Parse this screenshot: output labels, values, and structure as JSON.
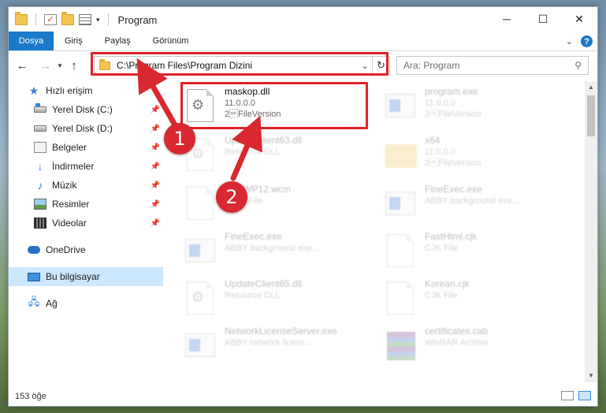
{
  "window": {
    "title": "Program",
    "controls": {
      "minimize": "─",
      "maximize": "☐",
      "close": "✕"
    }
  },
  "ribbon": {
    "tabs": [
      "Dosya",
      "Giriş",
      "Paylaş",
      "Görünüm"
    ],
    "help": "?"
  },
  "navigation": {
    "address": "C:\\Program Files\\Program Dizini",
    "search_placeholder": "Ara: Program"
  },
  "sidebar": {
    "quick_access": "Hızlı erişim",
    "pinned": [
      "Yerel Disk (C:)",
      "Yerel Disk (D:)",
      "Belgeler",
      "İndirmeler",
      "Müzik",
      "Resimler",
      "Videolar"
    ],
    "onedrive": "OneDrive",
    "this_pc": "Bu bilgisayar",
    "network": "Ağ"
  },
  "files": [
    {
      "name": "maskop.dll",
      "line1": "11.0.0.0",
      "line2": "2\u001fFileVersion",
      "icon": "dll-icon",
      "selected": true
    },
    {
      "name": "program.exe",
      "line1": "11.0.0.0",
      "line2": "2\u001fFileVersion",
      "icon": "exe-icon"
    },
    {
      "name": "UpdateClient63.dll",
      "line1": "Resource DLL",
      "line2": "",
      "icon": "dll-icon"
    },
    {
      "name": "x64",
      "line1": "11.0.0.0",
      "line2": "2\u001fFileVersion",
      "icon": "folder-icon"
    },
    {
      "name": "FineWP12.wcm",
      "line1": "WCM File",
      "line2": "",
      "icon": "file-icon"
    },
    {
      "name": "FineExec.exe",
      "line1": "ABBY background exe...",
      "line2": "",
      "icon": "exe-icon"
    },
    {
      "name": "FineExec.exe",
      "line1": "ABBY background exe...",
      "line2": "",
      "icon": "exe-icon"
    },
    {
      "name": "FastHtml.cjk",
      "line1": "CJK File",
      "line2": "",
      "icon": "file-icon"
    },
    {
      "name": "UpdateClient65.dll",
      "line1": "Resource DLL",
      "line2": "",
      "icon": "dll-icon"
    },
    {
      "name": "Korean.cjk",
      "line1": "CJK File",
      "line2": "",
      "icon": "file-icon"
    },
    {
      "name": "NetworkLicenseServer.exe",
      "line1": "ABBY network licens...",
      "line2": "",
      "icon": "exe-icon"
    },
    {
      "name": "certificates.cab",
      "line1": "WinRAR Archive",
      "line2": "",
      "icon": "rar-icon"
    }
  ],
  "status": {
    "count": "153 öğe"
  },
  "annotations": {
    "step1": "1",
    "step2": "2"
  },
  "colors": {
    "accent": "#1979ca",
    "highlight": "#e0222a",
    "badge": "#d9282f",
    "selection": "#cce8ff"
  }
}
